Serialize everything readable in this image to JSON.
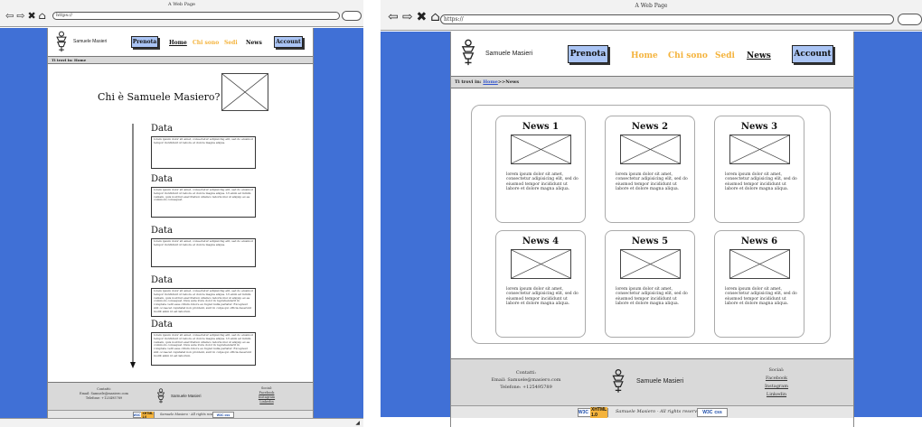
{
  "window_title": "A Web Page",
  "url": "https://",
  "brand": "Samuele Masieri",
  "buttons": {
    "prenota": "Prenota",
    "account": "Account"
  },
  "nav": {
    "home": "Home",
    "chi_sono": "Chi sono",
    "sedi": "Sedi",
    "news": "News"
  },
  "breadcrumb": {
    "prefix": "Ti trovi in:",
    "home_link": "Home",
    "sep": ">>",
    "current": "News"
  },
  "left_page": {
    "breadcrumb": "Ti trovi in: Home",
    "heading": "Chi è Samuele Masiero?",
    "data_label": "Data",
    "texts": [
      "lorem ipsum dolor sit amet, consectetur adipisicing elit, sed do eiusmod tempor incididunt ut labore et dolore magna aliqua.",
      "lorem ipsum dolor sit amet, consectetur adipisicing elit, sed do eiusmod tempor incididunt ut labore et dolore magna aliqua. Ut enim ad minim veniam, quis nostrud exercitation ullamco laboris nisi ut aliquip ex ea commodo consequat.",
      "lorem ipsum dolor sit amet, consectetur adipisicing elit, sed do eiusmod tempor incididunt ut labore et dolore magna aliqua.",
      "lorem ipsum dolor sit amet, consectetur adipisicing elit, sed do eiusmod tempor incididunt ut labore et dolore magna aliqua. Ut enim ad minim veniam, quis nostrud exercitation ullamco laboris nisi ut aliquip ex ea commodo consequat. Duis aute irure dolor in reprehenderit in voluptate velit esse cillum dolore eu fugiat nulla pariatur. Excepteur sint occaecat cupidatat non proident, sunt in culpa qui officia deserunt mollit anim id est laborum.",
      "lorem ipsum dolor sit amet, consectetur adipisicing elit, sed do eiusmod tempor incididunt ut labore et dolore magna aliqua. Ut enim ad minim veniam, quis nostrud exercitation ullamco laboris nisi ut aliquip ex ea commodo consequat. Duis aute irure dolor in reprehenderit in voluptate velit esse cillum dolore eu fugiat nulla pariatur. Excepteur sint occaecat cupidatat non proident, sunt in culpa qui officia deserunt mollit anim id est laborum."
    ]
  },
  "news": [
    {
      "title": "News 1",
      "text": "lorem ipsum dolor sit amet, consectetur adipisicing elit, sed do eiusmod tempor incididunt ut labore et dolore magna aliqua."
    },
    {
      "title": "News 2",
      "text": "lorem ipsum dolor sit amet, consectetur adipisicing elit, sed do eiusmod tempor incididunt ut labore et dolore magna aliqua."
    },
    {
      "title": "News 3",
      "text": "lorem ipsum dolor sit amet, consectetur adipisicing elit, sed do eiusmod tempor incididunt ut labore et dolore magna aliqua."
    },
    {
      "title": "News 4",
      "text": "lorem ipsum dolor sit amet, consectetur adipisicing elit, sed do eiusmod tempor incididunt ut labore et dolore magna aliqua."
    },
    {
      "title": "News 5",
      "text": "lorem ipsum dolor sit amet, consectetur adipisicing elit, sed do eiusmod tempor incididunt ut labore et dolore magna aliqua."
    },
    {
      "title": "News 6",
      "text": "lorem ipsum dolor sit amet, consectetur adipisicing elit, sed do eiusmod tempor incididunt ut labore et dolore magna aliqua."
    }
  ],
  "footer": {
    "contacts_title": "Contatti:",
    "email": "Email: Samuele@masiero.com",
    "phone": "Telefone: +125495789",
    "social_title": "Social:",
    "links": [
      "Facebook",
      "Instagram",
      "Linkedin"
    ],
    "rights": "Samuele Masiero - All rights reserved",
    "badge_html_w3c": "W3C",
    "badge_html_label": "XHTML 1.0",
    "badge_css_w3c": "W3C",
    "badge_css_label": "css"
  },
  "icons": [
    "back-arrow-icon",
    "forward-arrow-icon",
    "stop-icon",
    "home-icon",
    "search-icon",
    "logo-icon",
    "placeholder-image-icon",
    "scroll-arrow-icon"
  ],
  "colors": {
    "side_blue": "#4070d6",
    "button_blue": "#aac4f4",
    "nav_orange": "#f4b33c",
    "bar_gray": "#d9d9d9"
  }
}
